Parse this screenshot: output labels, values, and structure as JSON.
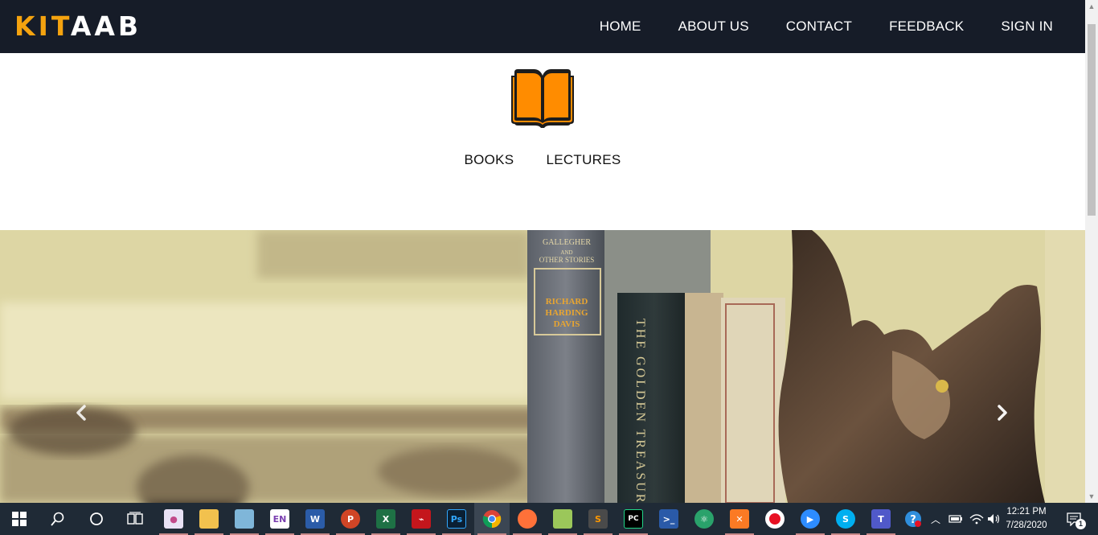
{
  "brand": {
    "part1": "KIT",
    "part2": "AAB",
    "accent": "#f5a30f"
  },
  "nav": {
    "home": "HOME",
    "about": "ABOUT US",
    "contact": "CONTACT",
    "feedback": "FEEDBACK",
    "signin": "SIGN IN"
  },
  "hero": {
    "icon": "open-book-icon",
    "links": {
      "books": "BOOKS",
      "lectures": "LECTURES"
    }
  },
  "carousel": {
    "prev_icon": "chevron-left-icon",
    "next_icon": "chevron-right-icon"
  },
  "taskbar": {
    "apps": [
      "start",
      "search",
      "cortana",
      "task-view",
      "paint",
      "file-explorer",
      "notepad",
      "onenote",
      "word",
      "powerpoint",
      "excel",
      "acrobat",
      "photoshop",
      "chrome",
      "firefox",
      "notepad-plus",
      "sublime-text",
      "pycharm",
      "powershell",
      "atom",
      "xampp",
      "obs",
      "zoom",
      "skype",
      "teams"
    ],
    "labels": {
      "onenote": "EN",
      "word": "W",
      "powerpoint": "P",
      "excel": "X",
      "photoshop": "Ps",
      "pycharm": "PC",
      "skype": "S",
      "teams": "T"
    },
    "clock": {
      "time": "12:21 PM",
      "date": "7/28/2020"
    },
    "notification_count": "1"
  }
}
